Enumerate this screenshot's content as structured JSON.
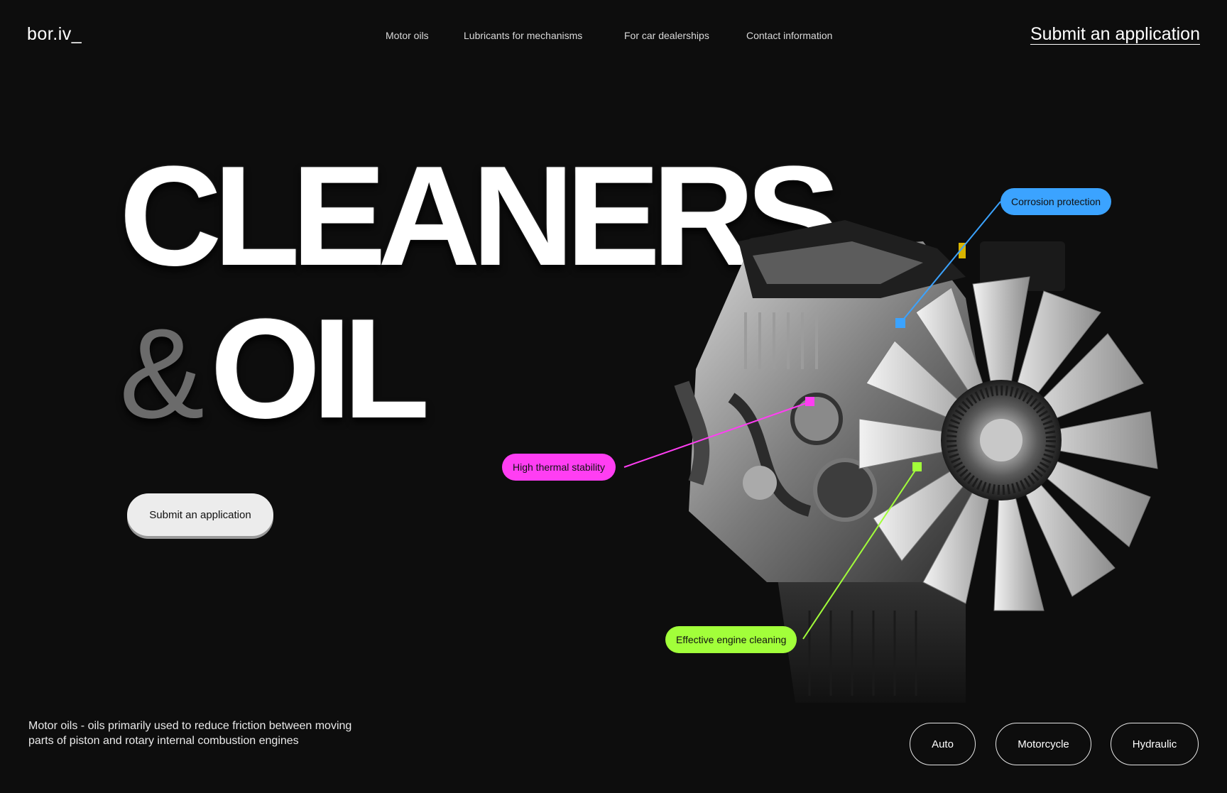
{
  "header": {
    "logo": "bor.iv_",
    "nav": [
      "Motor oils",
      "Lubricants for mechanisms",
      "For car dealerships",
      "Contact information"
    ],
    "cta": "Submit an application"
  },
  "hero": {
    "line1": "CLEANERS",
    "amp": "&",
    "line2": "OIL",
    "button": "Submit an application"
  },
  "callouts": {
    "corrosion": "Corrosion protection",
    "thermal": "High thermal stability",
    "cleaning": "Effective engine cleaning"
  },
  "colors": {
    "background": "#0d0d0d",
    "blue": "#3ba3ff",
    "pink": "#ff3ef3",
    "green": "#a2ff3a"
  },
  "footer": {
    "description": "Motor oils - oils primarily used to reduce friction between moving parts of piston and rotary internal combustion engines",
    "categories": [
      "Auto",
      "Motorcycle",
      "Hydraulic"
    ]
  }
}
